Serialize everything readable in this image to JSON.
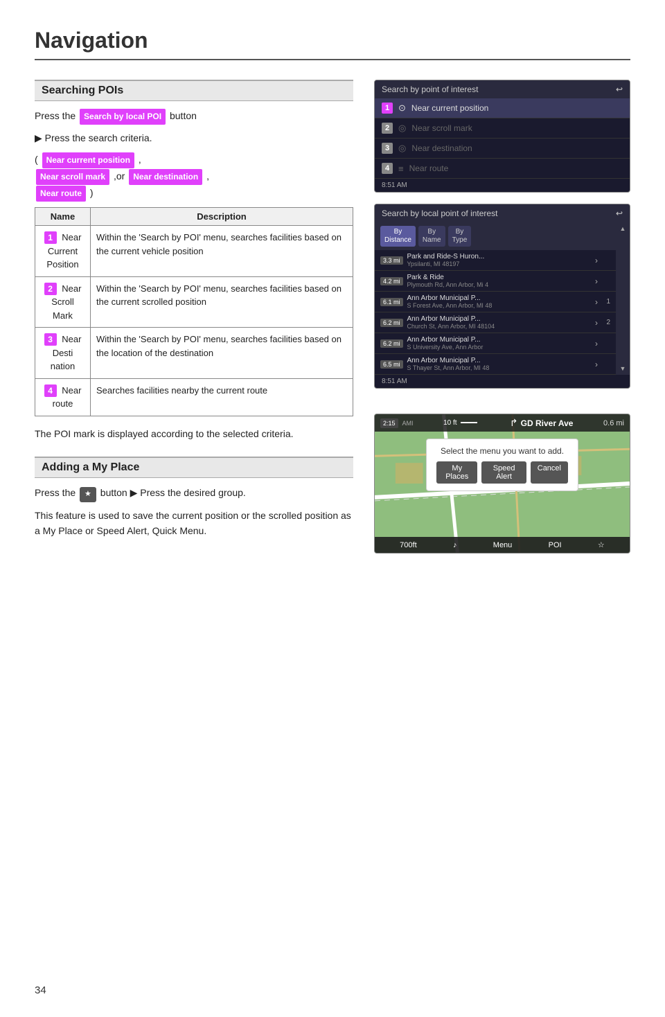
{
  "page": {
    "title": "Navigation",
    "number": "34"
  },
  "searching_pois": {
    "section_label": "Searching POIs",
    "intro_text_1": "Press the",
    "search_btn": "Search by local POI",
    "intro_text_2": "button",
    "step_text": "▶ Press the search criteria.",
    "paren_open": "(",
    "near_current_btn": "Near current position",
    "comma1": ",",
    "near_scroll_btn": "Near scroll mark",
    "or_text": ",or",
    "near_dest_btn": "Near destination",
    "comma2": ",",
    "near_route_btn": "Near route",
    "paren_close": ")",
    "table": {
      "col_name": "Name",
      "col_desc": "Description",
      "rows": [
        {
          "num": "1",
          "name": "Near\nCurrent\nPosition",
          "desc": "Within the 'Search by POI' menu, searches facilities based on the current vehicle position"
        },
        {
          "num": "2",
          "name": "Near\nScroll\nMark",
          "desc": "Within the 'Search by POI' menu, searches facilities based on the current scrolled position"
        },
        {
          "num": "3",
          "name": "Near\nDesti\nnation",
          "desc": "Within the 'Search by POI' menu, searches facilities based on the location of the destination"
        },
        {
          "num": "4",
          "name": "Near\nroute",
          "desc": "Searches facilities nearby the current route"
        }
      ]
    },
    "footer_text": "The POI mark is displayed according to the selected criteria."
  },
  "adding_my_place": {
    "section_label": "Adding a My Place",
    "intro_text_1": "Press the",
    "btn_icon": "★",
    "intro_text_2": "button ▶ Press the desired group.",
    "body_text": "This feature is used to save the current position or the scrolled position as a My Place or Speed Alert, Quick Menu."
  },
  "screen_poi": {
    "header": "Search by point of interest",
    "back_icon": "↩",
    "items": [
      {
        "num": "1",
        "num_class": "num-1",
        "icon": "⊙",
        "label": "Near current position",
        "active": true,
        "dimmed": false
      },
      {
        "num": "2",
        "num_class": "num-2",
        "icon": "◎",
        "label": "Near scroll mark",
        "active": false,
        "dimmed": true
      },
      {
        "num": "3",
        "num_class": "num-3",
        "icon": "◎",
        "label": "Near destination",
        "active": false,
        "dimmed": true
      },
      {
        "num": "4",
        "num_class": "num-4",
        "icon": "≡",
        "label": "Near route",
        "active": false,
        "dimmed": true
      }
    ],
    "time": "8:51 AM"
  },
  "screen_local_poi": {
    "header": "Search by local point of interest",
    "back_icon": "↩",
    "tabs": [
      {
        "label": "By\nDistance",
        "active": true
      },
      {
        "label": "By\nName",
        "active": false
      },
      {
        "label": "By\nType",
        "active": false
      }
    ],
    "items": [
      {
        "dist": "3.3 mi",
        "name": "Park and Ride-S Huron...",
        "sub": "Ypsilanti, MI 48197",
        "chevron": "›",
        "side": ""
      },
      {
        "dist": "4.2 mi",
        "name": "Park & Ride",
        "sub": "Plymouth Rd, Ann Arbor, Mi 4",
        "chevron": "›",
        "side": ""
      },
      {
        "dist": "6.1 mi",
        "name": "Ann Arbor Municipal P...",
        "sub": "S Forest Ave, Ann Arbor, MI 48",
        "chevron": "›",
        "side": "1"
      },
      {
        "dist": "6.2 mi",
        "name": "Ann Arbor Municipal P...",
        "sub": "Church St, Ann Arbor, MI 48104",
        "chevron": "›",
        "side": "2"
      },
      {
        "dist": "6.2 mi",
        "name": "Ann Arbor Municipal P...",
        "sub": "S University Ave, Ann Arbor",
        "chevron": "›",
        "side": ""
      },
      {
        "dist": "6.5 mi",
        "name": "Ann Arbor Municipal P...",
        "sub": "S Thayer St, Ann Arbor, MI 48",
        "chevron": "›",
        "side": ""
      }
    ],
    "time": "8:51 AM"
  },
  "screen_map": {
    "scale": "10 ft",
    "road": "GD River Ave",
    "dist": "0.6 mi",
    "time_eta": "2:15",
    "modal_text": "Select the menu you want to add.",
    "btns": [
      "My Places",
      "Speed Alert",
      "Cancel"
    ],
    "bottom_items": [
      "700ft",
      "♪",
      "Menu",
      "POI",
      "☆"
    ],
    "warning_icon": "⚠"
  }
}
